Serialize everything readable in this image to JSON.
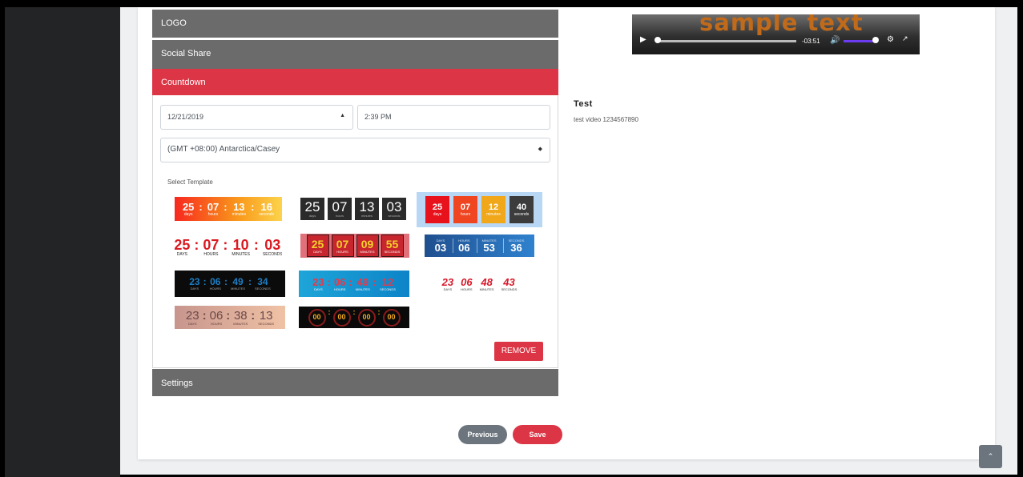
{
  "accordion": {
    "logo_label": "LOGO",
    "social_label": "Social Share",
    "countdown_label": "Countdown",
    "settings_label": "Settings"
  },
  "countdown": {
    "date_value": "12/21/2019",
    "time_value": "2:39 PM",
    "timezone_value": "(GMT +08:00) Antarctica/Casey",
    "select_template_label": "Select Template",
    "remove_label": "REMOVE"
  },
  "templates": [
    {
      "units": [
        "25",
        "07",
        "13",
        "16"
      ],
      "captions": [
        "days",
        "hours",
        "minutes",
        "seconds"
      ]
    },
    {
      "units": [
        "25",
        "07",
        "13",
        "03"
      ],
      "captions": [
        "days",
        "hours",
        "minutes",
        "seconds"
      ]
    },
    {
      "units": [
        "25",
        "07",
        "12",
        "40"
      ],
      "captions": [
        "days",
        "hours",
        "minutes",
        "seconds"
      ]
    },
    {
      "units": [
        "25",
        "07",
        "10",
        "03"
      ],
      "captions": [
        "DAYS",
        "HOURS",
        "MINUTES",
        "SECONDS"
      ]
    },
    {
      "units": [
        "25",
        "07",
        "09",
        "55"
      ],
      "captions": [
        "DAYS",
        "HOURS",
        "MINUTES",
        "SECONDS"
      ]
    },
    {
      "units": [
        "03",
        "06",
        "53",
        "36"
      ],
      "captions": [
        "DAYS",
        "HOURS",
        "MINUTES",
        "SECONDS"
      ]
    },
    {
      "units": [
        "23",
        "06",
        "49",
        "34"
      ],
      "captions": [
        "DAYS",
        "HOURS",
        "MINUTES",
        "SECONDS"
      ]
    },
    {
      "units": [
        "23",
        "06",
        "49",
        "12"
      ],
      "captions": [
        "DAYS",
        "HOURS",
        "MINUTES",
        "SECONDS"
      ]
    },
    {
      "units": [
        "23",
        "06",
        "48",
        "43"
      ],
      "captions": [
        "DAYS",
        "HOURS",
        "MINUTES",
        "SECONDS"
      ]
    },
    {
      "units": [
        "23",
        "06",
        "38",
        "13"
      ],
      "captions": [
        "DAYS",
        "HOURS",
        "MINUTES",
        "SECONDS"
      ]
    },
    {
      "units": [
        "00",
        "00",
        "00",
        "00"
      ],
      "captions": []
    }
  ],
  "buttons": {
    "previous_label": "Previous",
    "save_label": "Save"
  },
  "video": {
    "title_text": "sample text",
    "time": "-03:51"
  },
  "preview": {
    "title": "Test",
    "description": "test video 1234567890"
  },
  "colors": {
    "accent": "#dc3545",
    "header_gray": "#6b6b6b",
    "secondary": "#6c757d"
  }
}
